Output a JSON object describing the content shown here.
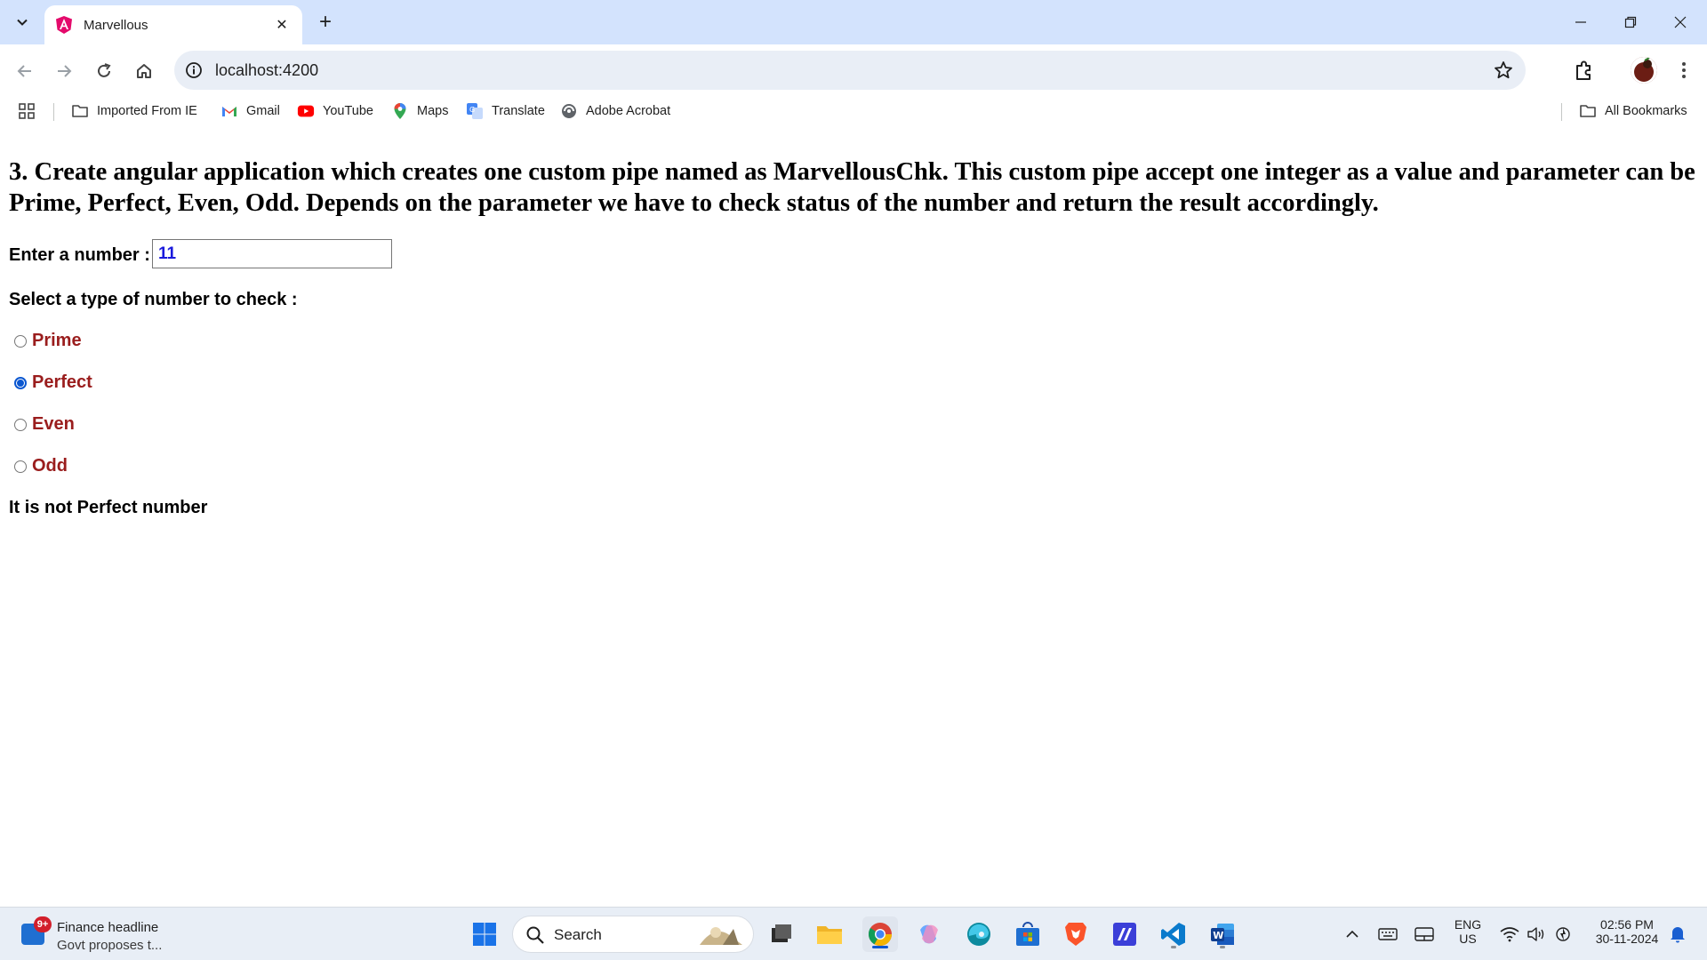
{
  "browser": {
    "tab_title": "Marvellous",
    "url": "localhost:4200",
    "bookmarks": [
      {
        "label": "Imported From IE",
        "icon": "folder-icon"
      },
      {
        "label": "Gmail",
        "icon": "gmail-icon"
      },
      {
        "label": "YouTube",
        "icon": "youtube-icon"
      },
      {
        "label": "Maps",
        "icon": "maps-icon"
      },
      {
        "label": "Translate",
        "icon": "translate-icon"
      },
      {
        "label": "Adobe Acrobat",
        "icon": "acrobat-icon"
      }
    ],
    "all_bookmarks": "All Bookmarks"
  },
  "page": {
    "heading": "3. Create angular application which creates one custom pipe named as MarvellousChk. This custom pipe accept one integer as a value and parameter can be Prime, Perfect, Even, Odd. Depends on the parameter we have to check status of the number and return the result accordingly.",
    "input_label": "Enter a number :",
    "input_value": "11",
    "select_label": "Select a type of number to check :",
    "options": [
      {
        "label": "Prime",
        "checked": false
      },
      {
        "label": "Perfect",
        "checked": true
      },
      {
        "label": "Even",
        "checked": false
      },
      {
        "label": "Odd",
        "checked": false
      }
    ],
    "result": "It is not Perfect number"
  },
  "taskbar": {
    "widget_badge": "9+",
    "widget_title": "Finance headline",
    "widget_subtitle": "Govt proposes t...",
    "search_placeholder": "Search",
    "language": "ENG",
    "region": "US",
    "time": "02:56 PM",
    "date": "30-11-2024"
  },
  "colors": {
    "tab_bar": "#d3e3fd",
    "option_label": "#9a1d1d",
    "input_text": "#1a1adc",
    "radio_checked": "#0b57d0"
  }
}
